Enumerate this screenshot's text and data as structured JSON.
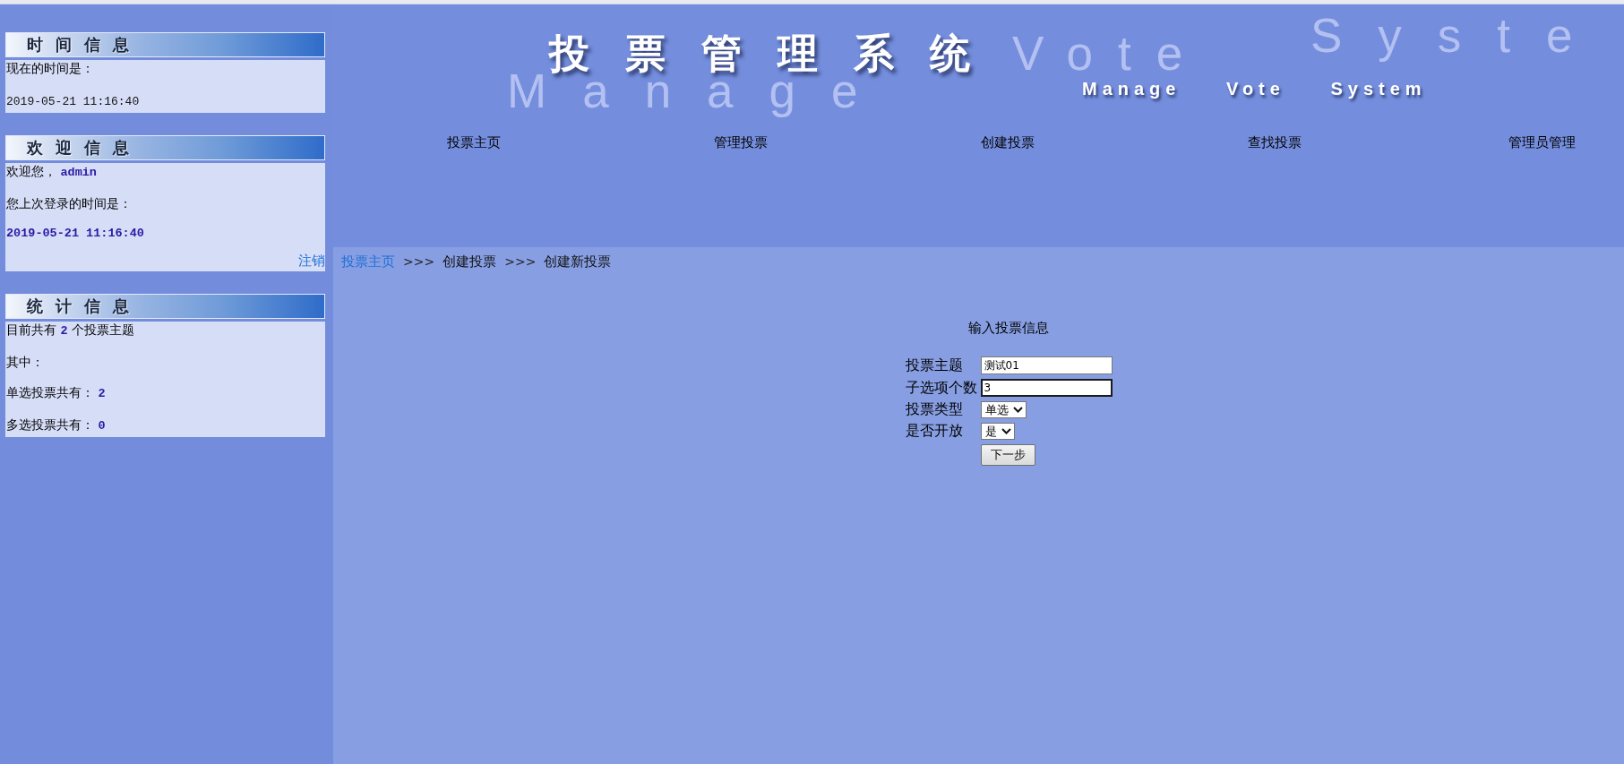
{
  "header": {
    "title": "投票管理系统",
    "subtitle": "Manage Vote System",
    "backdrop_words": [
      "Manage",
      "Vote",
      "Syste"
    ]
  },
  "nav": [
    {
      "label": "投票主页"
    },
    {
      "label": "管理投票"
    },
    {
      "label": "创建投票"
    },
    {
      "label": "查找投票"
    },
    {
      "label": "管理员管理"
    }
  ],
  "sidebar": [
    {
      "title": "时间信息",
      "lines": [
        {
          "kind": "text",
          "text": "现在的时间是："
        },
        {
          "kind": "time",
          "text": "2019-05-21 11:16:40"
        }
      ]
    },
    {
      "title": "欢迎信息",
      "lines": [
        {
          "kind": "text",
          "text": "欢迎您， **admin**"
        },
        {
          "kind": "text",
          "text": "您上次登录的时间是："
        },
        {
          "kind": "highlight",
          "text": "2019-05-21 11:16:40"
        }
      ],
      "link": "注销"
    },
    {
      "title": "统计信息",
      "lines": [
        {
          "kind": "text",
          "text": "目前共有 **2** 个投票主题"
        },
        {
          "kind": "text",
          "text": "其中："
        },
        {
          "kind": "text",
          "text": "单选投票共有： **2**"
        },
        {
          "kind": "text",
          "text": "多选投票共有： **0**"
        }
      ]
    }
  ],
  "breadcrumb": [
    {
      "kind": "link",
      "text": "投票主页"
    },
    {
      "kind": "separator",
      "text": ">>>"
    },
    {
      "kind": "text",
      "text": "创建投票"
    },
    {
      "kind": "separator",
      "text": ">>>"
    },
    {
      "kind": "text",
      "text": "创建新投票"
    }
  ],
  "form": {
    "heading": "输入投票信息",
    "fields": [
      {
        "kind": "text",
        "label": "投票主题",
        "value": "测试01",
        "focused": false
      },
      {
        "kind": "text",
        "label": "子选项个数",
        "value": "3",
        "focused": true
      },
      {
        "kind": "select",
        "label": "投票类型",
        "value": "单选",
        "focused": false
      },
      {
        "kind": "select",
        "label": "是否开放",
        "value": "是",
        "focused": false
      }
    ],
    "submit": "下一步"
  }
}
